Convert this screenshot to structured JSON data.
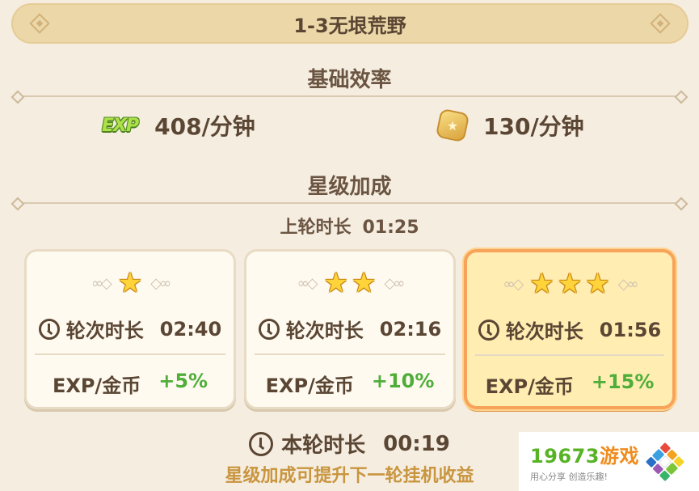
{
  "header": {
    "title": "1-3无垠荒野"
  },
  "efficiency": {
    "heading": "基础效率",
    "exp_icon_text": "EXP",
    "exp_rate": "408/分钟",
    "gold_rate": "130/分钟",
    "exp_icon": "exp-icon",
    "gold_icon": "gold-coin-icon"
  },
  "star_bonus": {
    "heading": "星级加成",
    "last_round_label": "上轮时长",
    "last_round_time": "01:25",
    "cards": [
      {
        "stars": 1,
        "duration_label": "轮次时长",
        "duration": "02:40",
        "bonus_label": "EXP/金币",
        "bonus": "+5%",
        "active": false
      },
      {
        "stars": 2,
        "duration_label": "轮次时长",
        "duration": "02:16",
        "bonus_label": "EXP/金币",
        "bonus": "+10%",
        "active": false
      },
      {
        "stars": 3,
        "duration_label": "轮次时长",
        "duration": "01:56",
        "bonus_label": "EXP/金币",
        "bonus": "+15%",
        "active": true
      }
    ]
  },
  "current_round": {
    "label": "本轮时长",
    "time": "00:19"
  },
  "hint": "星级加成可提升下一轮挂机收益",
  "watermark": {
    "number": "19673",
    "name": "游戏",
    "slogan": "用心分享 创造乐趣!"
  },
  "colors": {
    "background": "#f4ede0",
    "title_bar": "#ecd7a8",
    "text": "#5b4634",
    "bonus_green": "#4fae3a",
    "active_card": "#ffedb2",
    "active_border": "#f7a35a",
    "hint": "#c9953f"
  }
}
